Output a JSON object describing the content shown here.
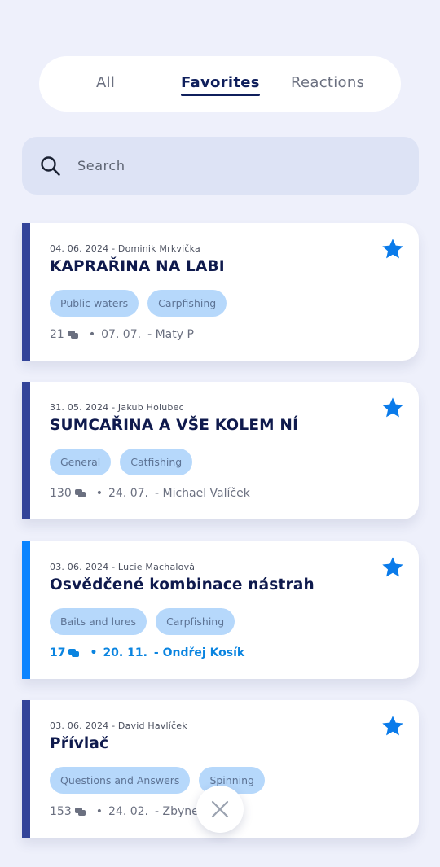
{
  "tabs": [
    {
      "label": "All",
      "active": false
    },
    {
      "label": "Favorites",
      "active": true
    },
    {
      "label": "Reactions",
      "active": false
    }
  ],
  "search": {
    "placeholder": "Search",
    "icon": "search-icon"
  },
  "posts": [
    {
      "meta": "04. 06. 2024 - Dominik Mrkvička",
      "title": "KAPRAŘINA NA LABI",
      "tags": [
        "Public waters",
        "Carpfishing"
      ],
      "replies": "21",
      "last_date": "07. 07.",
      "last_author": "- Maty P",
      "favorite": true
    },
    {
      "meta": "31. 05. 2024 - Jakub Holubec",
      "title": "SUMCAŘINA A VŠE KOLEM NÍ",
      "tags": [
        "General",
        "Catfishing"
      ],
      "replies": "130",
      "last_date": "24. 07.",
      "last_author": "- Michael Valíček",
      "favorite": true
    },
    {
      "meta": "03. 06. 2024 - Lucie Machalová",
      "title": "Osvědčené kombinace nástrah",
      "tags": [
        "Baits and lures",
        "Carpfishing"
      ],
      "replies": "17",
      "last_date": "20. 11.",
      "last_author": "- Ondřej Kosík",
      "favorite": true,
      "unread": true
    },
    {
      "meta": "03. 06. 2024 - David Havlíček",
      "title": "Přívlač",
      "tags": [
        "Questions and Answers",
        "Spinning"
      ],
      "replies": "153",
      "last_date": "24. 02.",
      "last_author": "- Zbynek K",
      "favorite": true
    }
  ],
  "separator": "•",
  "colors": {
    "background": "#eef0fb",
    "accent_bar": "#334499",
    "unread_accent": "#0a84ff",
    "star": "#0a7bea",
    "tag_bg": "#b6d8fb",
    "title": "#0f1a4d"
  },
  "fab": {
    "icon": "close-icon"
  }
}
